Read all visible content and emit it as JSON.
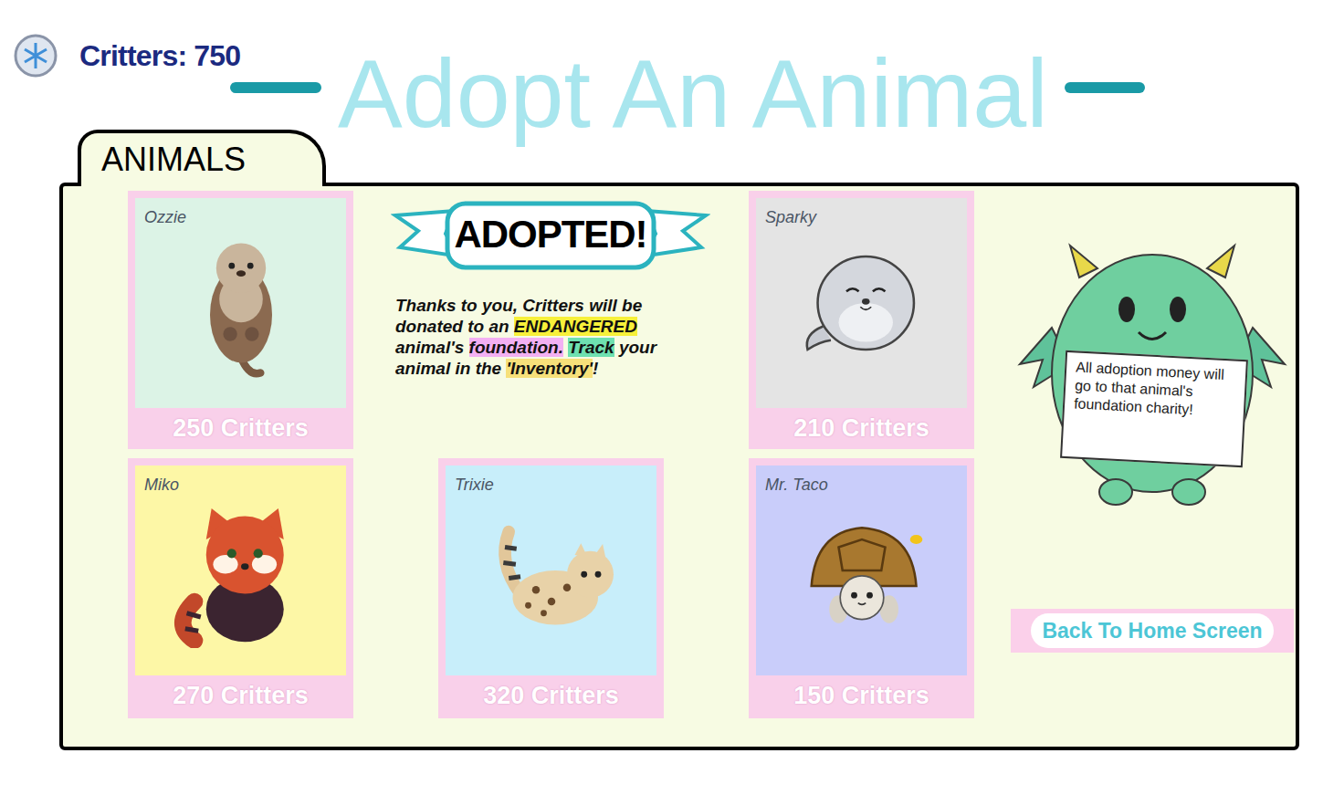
{
  "currency": {
    "label": "Critters: 750"
  },
  "title": "Adopt An Animal",
  "tabs": [
    {
      "label": "ANIMALS",
      "selected": true
    }
  ],
  "animals": [
    {
      "name": "Ozzie",
      "kind": "otter",
      "price": "250 Critters",
      "color": "#dcf3e6"
    },
    {
      "name": "Sparky",
      "kind": "seal",
      "price": "210 Critters",
      "color": "#e4e4e4"
    },
    {
      "name": "Miko",
      "kind": "red-panda",
      "price": "270 Critters",
      "color": "#fdf7a6"
    },
    {
      "name": "Trixie",
      "kind": "leopard",
      "price": "320 Critters",
      "color": "#c8eefa"
    },
    {
      "name": "Mr. Taco",
      "kind": "tortoise",
      "price": "150 Critters",
      "color": "#c9cdfa"
    }
  ],
  "notice": {
    "badge": "ADOPTED!",
    "segments": [
      {
        "text": "Thanks to you, Critters will be donated to an ",
        "highlight": null
      },
      {
        "text": "ENDANGERED",
        "highlight": "#f7f03a"
      },
      {
        "text": " animal's ",
        "highlight": null
      },
      {
        "text": "foundation.",
        "highlight": "#f3b0f3"
      },
      {
        "text": " ",
        "highlight": null
      },
      {
        "text": "Track",
        "highlight": "#6ee0b0"
      },
      {
        "text": " your animal in the ",
        "highlight": null
      },
      {
        "text": "'Inventory'",
        "highlight": "#f7e07a"
      },
      {
        "text": "!",
        "highlight": null
      }
    ]
  },
  "mascot": {
    "sign": "All adoption money will go to that animal's foundation charity!"
  },
  "buttons": [
    "Back To Home Screen"
  ]
}
